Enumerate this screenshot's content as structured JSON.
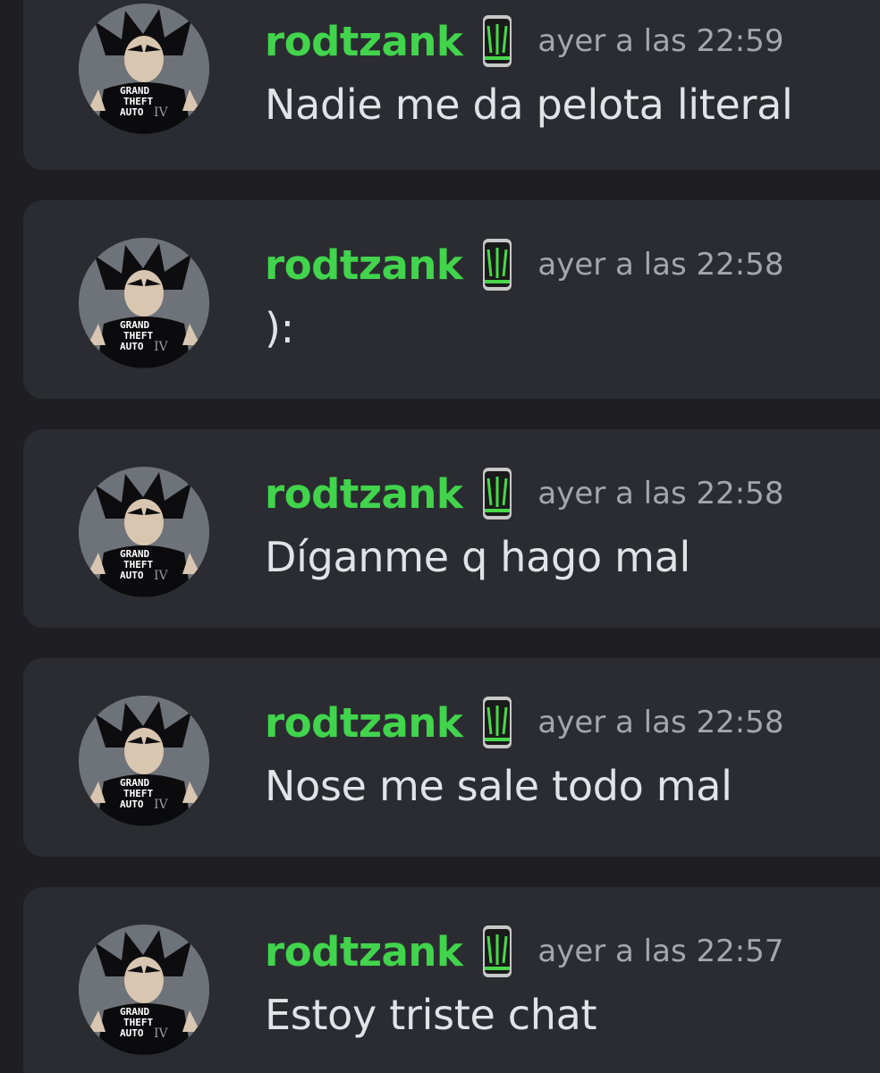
{
  "messages": [
    {
      "username": "rodtzank",
      "timestamp": "ayer a las 22:59",
      "text": "Nadie me da pelota literal",
      "avatar_icon": "anime-character-gta-shirt-avatar",
      "badge_icon": "monster-energy-can-icon"
    },
    {
      "username": "rodtzank",
      "timestamp": "ayer a las 22:58",
      "text": "):",
      "avatar_icon": "anime-character-gta-shirt-avatar",
      "badge_icon": "monster-energy-can-icon"
    },
    {
      "username": "rodtzank",
      "timestamp": "ayer a las 22:58",
      "text": "Díganme q hago mal",
      "avatar_icon": "anime-character-gta-shirt-avatar",
      "badge_icon": "monster-energy-can-icon"
    },
    {
      "username": "rodtzank",
      "timestamp": "ayer a las 22:58",
      "text": "Nose me sale todo mal",
      "avatar_icon": "anime-character-gta-shirt-avatar",
      "badge_icon": "monster-energy-can-icon"
    },
    {
      "username": "rodtzank",
      "timestamp": "ayer a las 22:57",
      "text": "Estoy triste chat",
      "avatar_icon": "anime-character-gta-shirt-avatar",
      "badge_icon": "monster-energy-can-icon"
    }
  ],
  "avatar_shirt_text": [
    "GRAND",
    "THEFT",
    "AUTO",
    "IV"
  ],
  "colors": {
    "background": "#1f1f23",
    "message_card": "#2b2c31",
    "username": "#41d44c",
    "timestamp": "#a3a6ad",
    "message_text": "#e2e3e6"
  }
}
